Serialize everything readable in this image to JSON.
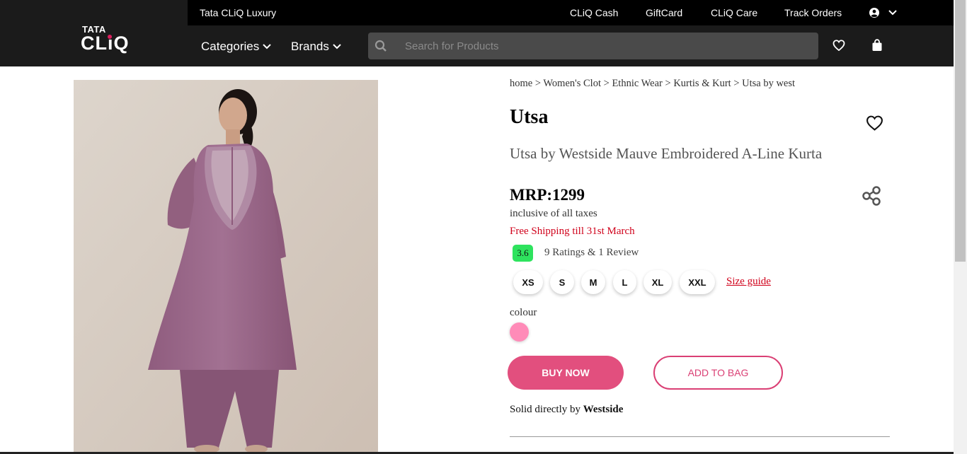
{
  "header": {
    "luxury_link": "Tata CLiQ Luxury",
    "links": [
      "CLiQ Cash",
      "GiftCard",
      "CLiQ Care",
      "Track Orders"
    ],
    "logo_top": "TATA",
    "logo_bottom": "CLiQ",
    "nav": [
      "Categories",
      "Brands"
    ],
    "search_placeholder": "Search for Products"
  },
  "product": {
    "breadcrumb": [
      "home",
      "Women's Clot",
      "Ethnic Wear",
      "Kurtis & Kurt",
      "Utsa by west"
    ],
    "breadcrumb_sep": " > ",
    "brand": "Utsa",
    "title": "Utsa by Westside Mauve Embroidered A-Line Kurta",
    "price": "MRP:1299",
    "taxes": "inclusive of all taxes",
    "shipping": "Free Shipping till 31st March",
    "rating": "3.6",
    "rating_text": "9 Ratings & 1 Review",
    "sizes": [
      "XS",
      "S",
      "M",
      "L",
      "XL",
      "XXL"
    ],
    "size_guide": "Size guide",
    "colour_label": "colour",
    "colour_swatch": "#ff8bb8",
    "buy_now": "BUY NOW",
    "add_to_bag": "ADD TO BAG",
    "seller_prefix": "Solid directly by",
    "seller_name": "Westside"
  },
  "colors": {
    "accent": "#e24f7e",
    "rating_badge": "#2ee35e",
    "shipping_text": "#d0021b"
  }
}
